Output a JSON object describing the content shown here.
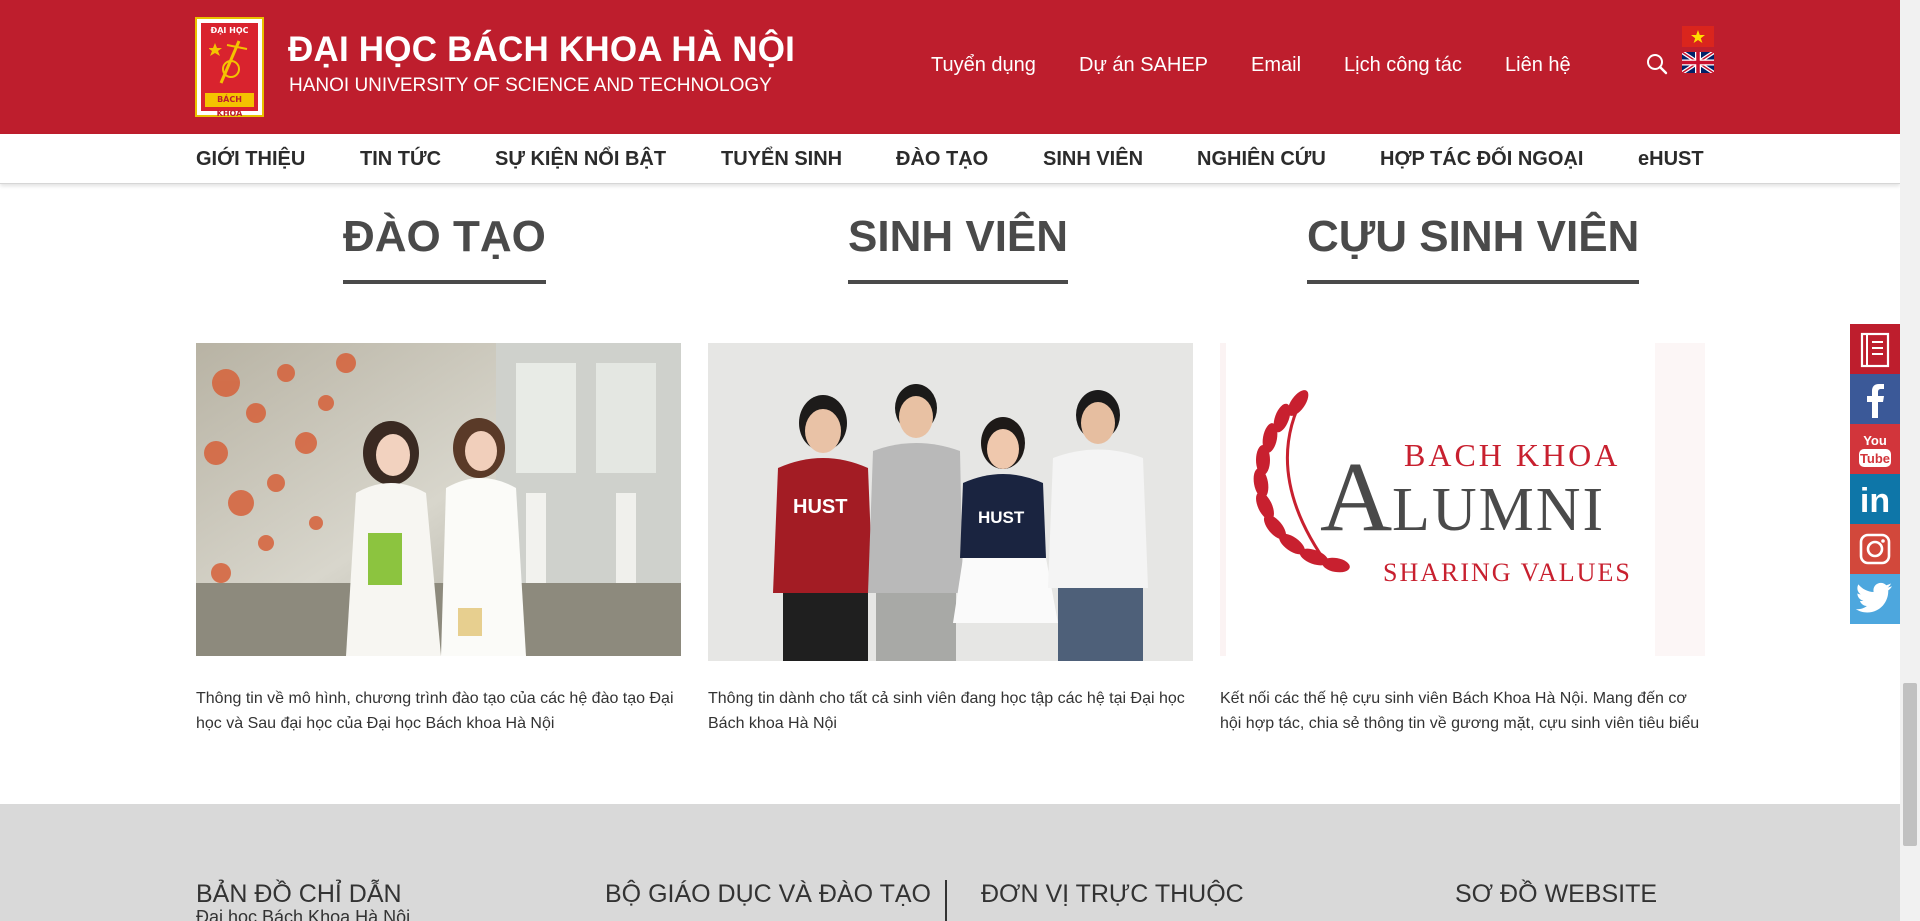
{
  "header": {
    "logo_top": "ĐẠI HỌC",
    "logo_bottom": "BÁCH KHOA",
    "title": "ĐẠI HỌC BÁCH KHOA HÀ NỘI",
    "subtitle": "HANOI UNIVERSITY OF SCIENCE AND TECHNOLOGY",
    "links": [
      "Tuyển dụng",
      "Dự án SAHEP",
      "Email",
      "Lịch công tác",
      "Liên hệ"
    ],
    "accent_color": "#be1e2d"
  },
  "mainnav": {
    "items": [
      "GIỚI THIỆU",
      "TIN TỨC",
      "SỰ KIỆN NỔI BẬT",
      "TUYỂN SINH",
      "ĐÀO TẠO",
      "SINH VIÊN",
      "NGHIÊN CỨU",
      "HỢP TÁC ĐỐI NGOẠI",
      "eHUST"
    ]
  },
  "sections": [
    {
      "heading": "ĐÀO TẠO",
      "description": "Thông tin về mô hình, chương trình đào tạo của các hệ đào tạo Đại học và Sau đại học của Đại học Bách khoa Hà Nội"
    },
    {
      "heading": "SINH VIÊN",
      "description": "Thông tin dành cho tất cả sinh viên đang học tập các hệ tại Đại học Bách khoa Hà Nội",
      "shirt_text": "HUST"
    },
    {
      "heading": "CỰU SINH VIÊN",
      "description": "Kết nối các thế hệ cựu sinh viên Bách Khoa Hà Nội. Mang đến cơ hội hợp tác, chia sẻ thông tin về gương mặt, cựu sinh viên tiêu biểu",
      "alumni_logo": {
        "line1": "BACH KHOA",
        "line2_initial": "A",
        "line2_rest": "LUMNI",
        "line3": "SHARING VALUES"
      }
    }
  ],
  "social": {
    "items": [
      "ebook-icon",
      "facebook-icon",
      "youtube-icon",
      "linkedin-icon",
      "instagram-icon",
      "twitter-icon"
    ],
    "youtube_top": "You",
    "youtube_bottom": "Tube",
    "linkedin_text": "in"
  },
  "footer": {
    "columns": [
      "BẢN ĐỒ CHỈ DẪN",
      "BỘ GIÁO DỤC VÀ ĐÀO TẠO",
      "ĐƠN VỊ TRỰC THUỘC",
      "SƠ ĐỒ WEBSITE"
    ],
    "map_sub": "Đại học Bách Khoa Hà Nội"
  }
}
